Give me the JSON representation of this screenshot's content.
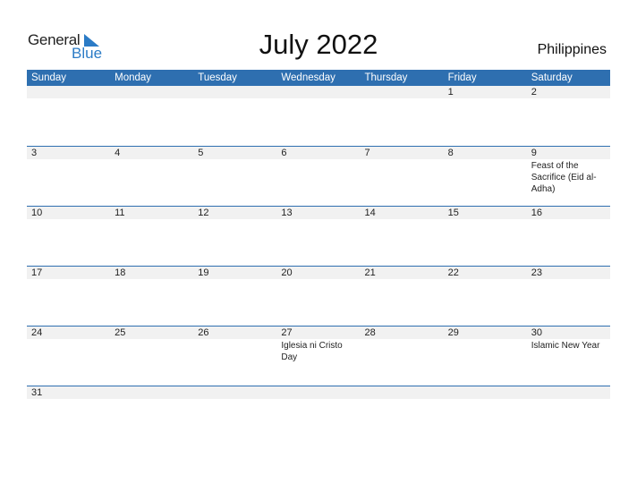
{
  "logo": {
    "word1": "General",
    "word2": "Blue"
  },
  "header": {
    "title": "July 2022",
    "country": "Philippines"
  },
  "colors": {
    "accent": "#2e6fb0",
    "logo_blue": "#2b7bc6",
    "day_strip": "#f1f1f1"
  },
  "weekdays": [
    "Sunday",
    "Monday",
    "Tuesday",
    "Wednesday",
    "Thursday",
    "Friday",
    "Saturday"
  ],
  "weeks": [
    [
      {
        "day": ""
      },
      {
        "day": ""
      },
      {
        "day": ""
      },
      {
        "day": ""
      },
      {
        "day": ""
      },
      {
        "day": "1"
      },
      {
        "day": "2"
      }
    ],
    [
      {
        "day": "3"
      },
      {
        "day": "4"
      },
      {
        "day": "5"
      },
      {
        "day": "6"
      },
      {
        "day": "7"
      },
      {
        "day": "8"
      },
      {
        "day": "9",
        "holiday": "Feast of the Sacrifice (Eid al-Adha)"
      }
    ],
    [
      {
        "day": "10"
      },
      {
        "day": "11"
      },
      {
        "day": "12"
      },
      {
        "day": "13"
      },
      {
        "day": "14"
      },
      {
        "day": "15"
      },
      {
        "day": "16"
      }
    ],
    [
      {
        "day": "17"
      },
      {
        "day": "18"
      },
      {
        "day": "19"
      },
      {
        "day": "20"
      },
      {
        "day": "21"
      },
      {
        "day": "22"
      },
      {
        "day": "23"
      }
    ],
    [
      {
        "day": "24"
      },
      {
        "day": "25"
      },
      {
        "day": "26"
      },
      {
        "day": "27",
        "holiday": "Iglesia ni Cristo Day"
      },
      {
        "day": "28"
      },
      {
        "day": "29"
      },
      {
        "day": "30",
        "holiday": "Islamic New Year"
      }
    ],
    [
      {
        "day": "31"
      },
      {
        "day": ""
      },
      {
        "day": ""
      },
      {
        "day": ""
      },
      {
        "day": ""
      },
      {
        "day": ""
      },
      {
        "day": ""
      }
    ]
  ]
}
